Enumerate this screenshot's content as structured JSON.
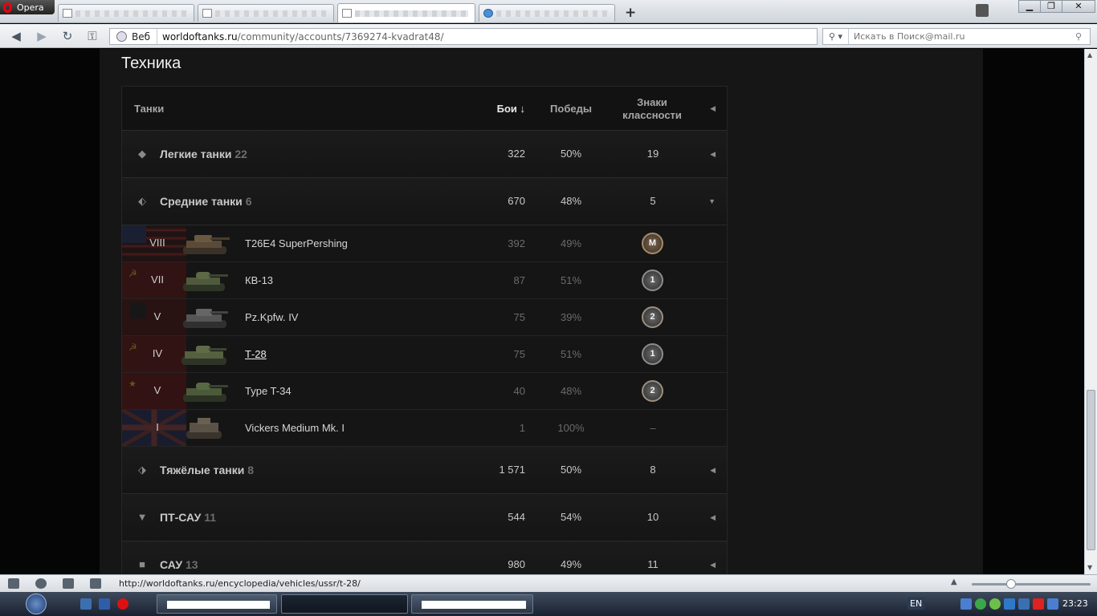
{
  "browser": {
    "app_name": "Opera",
    "web_label": "Веб",
    "url_domain": "worldoftanks.ru",
    "url_path": "/community/accounts/7369274-kvadrat48/",
    "search_placeholder": "Искать в Поиск@mail.ru",
    "new_tab": "+",
    "min": "▁",
    "restore": "❐",
    "close": "✕"
  },
  "page": {
    "section_title": "Техника",
    "header": {
      "tanks": "Танки",
      "battles": "Бои ↓",
      "wins": "Победы",
      "marks": "Знаки классности"
    },
    "groups": [
      {
        "name": "Легкие танки",
        "count": "22",
        "battles": "322",
        "wins": "50%",
        "marks": "19"
      },
      {
        "name": "Средние танки",
        "count": "6",
        "battles": "670",
        "wins": "48%",
        "marks": "5"
      },
      {
        "name": "Тяжёлые танки",
        "count": "8",
        "battles": "1 571",
        "wins": "50%",
        "marks": "8"
      },
      {
        "name": "ПТ-САУ",
        "count": "11",
        "battles": "544",
        "wins": "54%",
        "marks": "10"
      },
      {
        "name": "САУ",
        "count": "13",
        "battles": "980",
        "wins": "49%",
        "marks": "11"
      }
    ],
    "vehicles": [
      {
        "tier": "VIII",
        "name": "T26E4 SuperPershing",
        "battles": "392",
        "wins": "49%",
        "mark": "M"
      },
      {
        "tier": "VII",
        "name": "КВ-13",
        "battles": "87",
        "wins": "51%",
        "mark": "1"
      },
      {
        "tier": "V",
        "name": "Pz.Kpfw. IV",
        "battles": "75",
        "wins": "39%",
        "mark": "2"
      },
      {
        "tier": "IV",
        "name": "Т-28",
        "battles": "75",
        "wins": "51%",
        "mark": "1"
      },
      {
        "tier": "V",
        "name": "Type T-34",
        "battles": "40",
        "wins": "48%",
        "mark": "2"
      },
      {
        "tier": "I",
        "name": "Vickers Medium Mk. I",
        "battles": "1",
        "wins": "100%",
        "mark": "–"
      }
    ]
  },
  "status": {
    "hover_url": "http://worldoftanks.ru/encyclopedia/vehicles/ussr/t-28/"
  },
  "taskbar": {
    "lang": "EN",
    "clock": "23:23"
  }
}
